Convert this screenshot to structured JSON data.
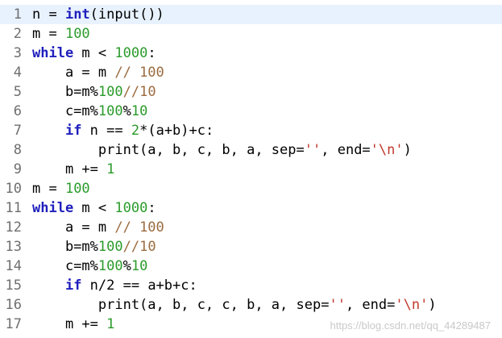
{
  "editor": {
    "lines": [
      {
        "number": "1",
        "tokens": [
          {
            "t": "n = ",
            "c": "op"
          },
          {
            "t": "int",
            "c": "kw"
          },
          {
            "t": "(input())",
            "c": "op"
          }
        ]
      },
      {
        "number": "2",
        "tokens": [
          {
            "t": "m = ",
            "c": "op"
          },
          {
            "t": "100",
            "c": "num"
          }
        ]
      },
      {
        "number": "3",
        "tokens": [
          {
            "t": "while",
            "c": "kw"
          },
          {
            "t": " m < ",
            "c": "op"
          },
          {
            "t": "1000",
            "c": "num"
          },
          {
            "t": ":",
            "c": "op"
          }
        ]
      },
      {
        "number": "4",
        "tokens": [
          {
            "t": "    a = m ",
            "c": "op"
          },
          {
            "t": "// 100",
            "c": "cmt"
          }
        ]
      },
      {
        "number": "5",
        "tokens": [
          {
            "t": "    b=m%",
            "c": "op"
          },
          {
            "t": "100",
            "c": "num"
          },
          {
            "t": "//10",
            "c": "cmt"
          }
        ]
      },
      {
        "number": "6",
        "tokens": [
          {
            "t": "    c=m%",
            "c": "op"
          },
          {
            "t": "100",
            "c": "num"
          },
          {
            "t": "%",
            "c": "op"
          },
          {
            "t": "10",
            "c": "num"
          }
        ]
      },
      {
        "number": "7",
        "tokens": [
          {
            "t": "    ",
            "c": "op"
          },
          {
            "t": "if",
            "c": "kw"
          },
          {
            "t": " n == ",
            "c": "op"
          },
          {
            "t": "2",
            "c": "num"
          },
          {
            "t": "*(a+b)+c:",
            "c": "op"
          }
        ]
      },
      {
        "number": "8",
        "tokens": [
          {
            "t": "        print(a, b, c, b, a, sep=",
            "c": "op"
          },
          {
            "t": "''",
            "c": "str"
          },
          {
            "t": ", end=",
            "c": "op"
          },
          {
            "t": "'\\n'",
            "c": "str"
          },
          {
            "t": ")",
            "c": "op"
          }
        ]
      },
      {
        "number": "9",
        "tokens": [
          {
            "t": "    m += ",
            "c": "op"
          },
          {
            "t": "1",
            "c": "num"
          }
        ]
      },
      {
        "number": "10",
        "tokens": [
          {
            "t": "m = ",
            "c": "op"
          },
          {
            "t": "100",
            "c": "num"
          }
        ]
      },
      {
        "number": "11",
        "tokens": [
          {
            "t": "while",
            "c": "kw"
          },
          {
            "t": " m < ",
            "c": "op"
          },
          {
            "t": "1000",
            "c": "num"
          },
          {
            "t": ":",
            "c": "op"
          }
        ]
      },
      {
        "number": "12",
        "tokens": [
          {
            "t": "    a = m ",
            "c": "op"
          },
          {
            "t": "// 100",
            "c": "cmt"
          }
        ]
      },
      {
        "number": "13",
        "tokens": [
          {
            "t": "    b=m%",
            "c": "op"
          },
          {
            "t": "100",
            "c": "num"
          },
          {
            "t": "//10",
            "c": "cmt"
          }
        ]
      },
      {
        "number": "14",
        "tokens": [
          {
            "t": "    c=m%",
            "c": "op"
          },
          {
            "t": "100",
            "c": "num"
          },
          {
            "t": "%",
            "c": "op"
          },
          {
            "t": "10",
            "c": "num"
          }
        ]
      },
      {
        "number": "15",
        "tokens": [
          {
            "t": "    ",
            "c": "op"
          },
          {
            "t": "if",
            "c": "kw"
          },
          {
            "t": " n/2 == a+b+c:",
            "c": "op"
          }
        ]
      },
      {
        "number": "16",
        "tokens": [
          {
            "t": "        print(a, b, c, c, b, a, sep=",
            "c": "op"
          },
          {
            "t": "''",
            "c": "str"
          },
          {
            "t": ", end=",
            "c": "op"
          },
          {
            "t": "'\\n'",
            "c": "str"
          },
          {
            "t": ")",
            "c": "op"
          }
        ]
      },
      {
        "number": "17",
        "tokens": [
          {
            "t": "    m += ",
            "c": "op"
          },
          {
            "t": "1",
            "c": "num"
          }
        ]
      }
    ]
  },
  "watermark": "https://blog.csdn.net/qq_44289487",
  "colors": {
    "keyword": "#1f1fbd",
    "number": "#2b9b2b",
    "comment": "#9b6b3f",
    "string": "#c0392b",
    "line_number": "#6f6f6f",
    "current_line": "#e8f2fe"
  }
}
